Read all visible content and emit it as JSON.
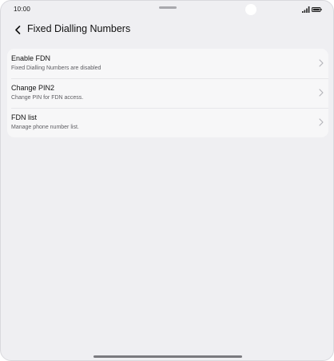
{
  "status_bar": {
    "time": "10:00",
    "icons": [
      "signal-icon",
      "battery-icon"
    ]
  },
  "header": {
    "back_icon": "chevron-left-icon",
    "title": "Fixed Dialling Numbers"
  },
  "settings": {
    "items": [
      {
        "title": "Enable FDN",
        "subtitle": "Fixed Dialling Numbers are disabled",
        "icon": "chevron-right-icon"
      },
      {
        "title": "Change PIN2",
        "subtitle": "Change PIN for FDN access.",
        "icon": "chevron-right-icon"
      },
      {
        "title": "FDN list",
        "subtitle": "Manage phone number list.",
        "icon": "chevron-right-icon"
      }
    ]
  },
  "colors": {
    "background": "#efeff2",
    "card": "#f7f7f8",
    "text_primary": "#111111",
    "text_secondary": "#5e5e63"
  }
}
